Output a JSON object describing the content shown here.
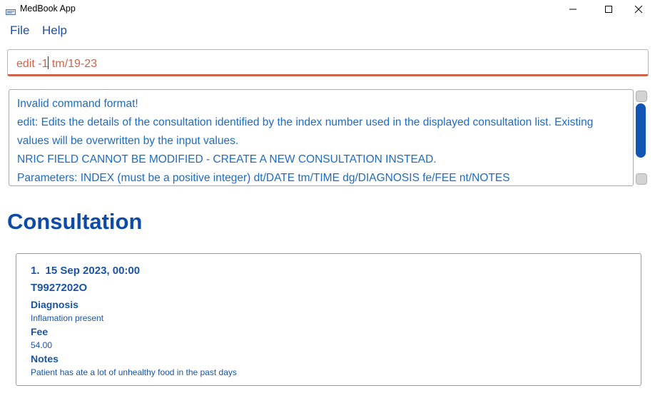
{
  "window": {
    "title": "MedBook App",
    "controls": [
      "minimize",
      "maximize",
      "close"
    ]
  },
  "menu": {
    "file_label": "File",
    "help_label": "Help"
  },
  "command": {
    "value_before_caret": "edit -1",
    "value_after_caret": " tm/19-23"
  },
  "result": {
    "lines": [
      "Invalid command format!",
      "edit: Edits the details of the consultation identified by the index number used in the displayed consultation list. Existing",
      "values will be overwritten by the input values.",
      "NRIC FIELD CANNOT BE MODIFIED - CREATE A NEW CONSULTATION INSTEAD.",
      "Parameters: INDEX (must be a positive integer) dt/DATE tm/TIME dg/DIAGNOSIS fe/FEE nt/NOTES"
    ]
  },
  "section": {
    "heading": "Consultation"
  },
  "consultations": [
    {
      "index": "1.",
      "datetime": "15 Sep 2023, 00:00",
      "nric": "T9927202O",
      "diagnosis_label": "Diagnosis",
      "diagnosis": "Inflamation present",
      "fee_label": "Fee",
      "fee": "54.00",
      "notes_label": "Notes",
      "notes": "Patient has ate a lot of unhealthy food in the past days"
    }
  ],
  "colors": {
    "accent_blue": "#0e4aa8",
    "text_blue": "#1f6bc0",
    "error_orange": "#d0634a",
    "scroll_thumb": "#1054b6"
  }
}
